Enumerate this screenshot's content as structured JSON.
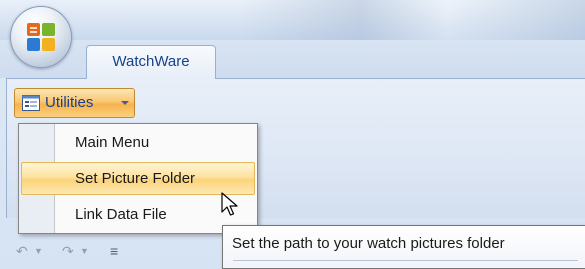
{
  "ribbon": {
    "tab_label": "WatchWare",
    "utilities_button_label": "Utilities",
    "utilities_icon": "list-form-icon",
    "dropdown_icon": "chevron-down-icon"
  },
  "menu": {
    "items": [
      {
        "label": "Main Menu",
        "highlighted": false
      },
      {
        "label": "Set Picture Folder",
        "highlighted": true
      },
      {
        "label": "Link Data File",
        "highlighted": false
      }
    ]
  },
  "tooltip": {
    "text": "Set the path to your watch pictures folder"
  },
  "quick_access": {
    "undo_icon": "undo-icon",
    "redo_icon": "redo-icon",
    "customize_icon": "customize-toolbar-icon"
  },
  "colors": {
    "accent_text": "#15428b",
    "highlight": "#fbd37a",
    "ribbon_bg": "#dfe8f5"
  }
}
